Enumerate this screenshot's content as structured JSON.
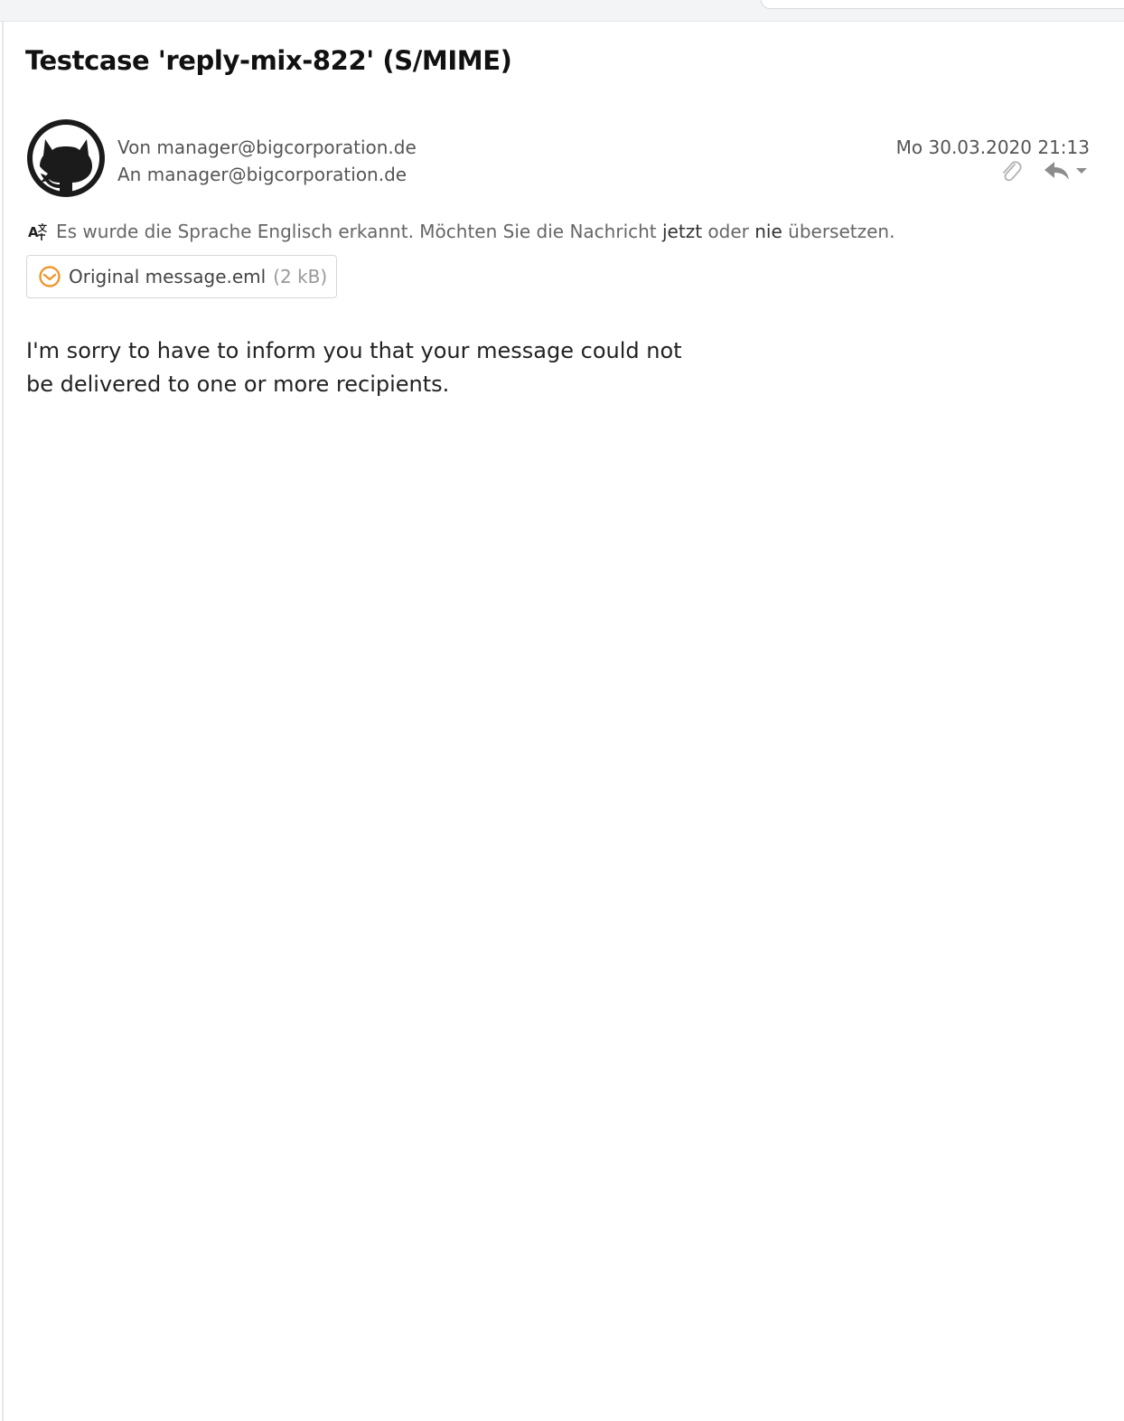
{
  "message": {
    "subject": "Testcase 'reply-mix-822' (S/MIME)",
    "from_label": "Von",
    "from": "manager@bigcorporation.de",
    "to_label": "An",
    "to": "manager@bigcorporation.de",
    "date": "Mo 30.03.2020 21:13",
    "avatar_icon": "github-octocat-icon"
  },
  "actions": {
    "attachment_icon": "paperclip-icon",
    "reply_icon": "reply-icon",
    "more_icon": "chevron-down-icon"
  },
  "translation": {
    "icon": "translate-icon",
    "text_before": "Es wurde die Sprache Englisch erkannt. Möchten Sie die Nachricht",
    "link_now": "jetzt",
    "text_middle": "oder",
    "link_never": "nie",
    "text_after": "übersetzen."
  },
  "attachment": {
    "icon": "email-file-icon",
    "name": "Original message.eml",
    "size": "(2 kB)",
    "icon_color": "#f0962d"
  },
  "body": {
    "line1": "I'm sorry to have to inform you that your message could not",
    "line2": "be delivered to one or more recipients."
  }
}
